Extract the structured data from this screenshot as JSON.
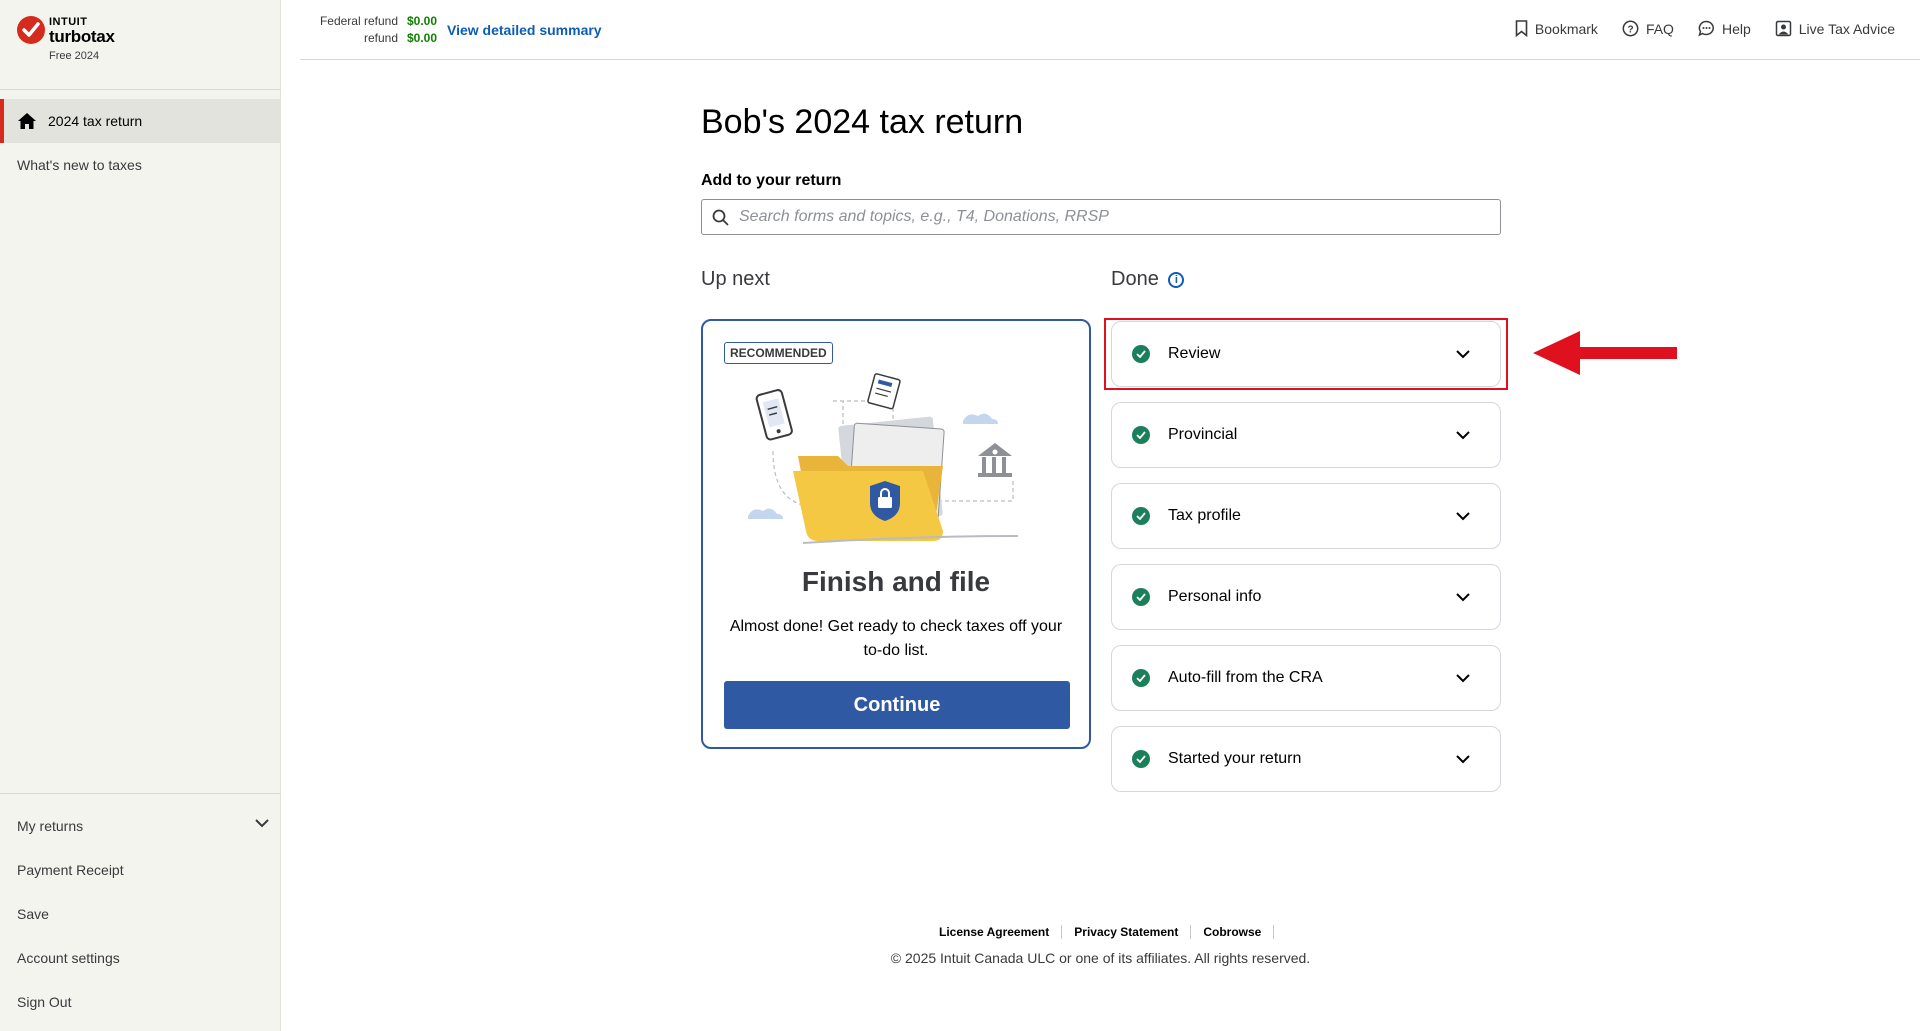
{
  "brand": {
    "top": "INTUIT",
    "name": "turbotax",
    "edition": "Free 2024",
    "accent": "#d52b1e"
  },
  "sidebar": {
    "active_item": "2024 tax return",
    "links": [
      "What's new to taxes"
    ],
    "bottom": [
      "My returns",
      "Payment Receipt",
      "Save",
      "Account settings",
      "Sign Out"
    ]
  },
  "header": {
    "refund_label_1": "Federal refund",
    "refund_label_2": "refund",
    "refund_value_1": "$0.00",
    "refund_value_2": "$0.00",
    "summary_link": "View detailed summary",
    "nav": [
      "Bookmark",
      "FAQ",
      "Help",
      "Live Tax Advice"
    ]
  },
  "main": {
    "title": "Bob's 2024 tax return",
    "add_label": "Add to your return",
    "search_placeholder": "Search forms and topics, e.g., T4, Donations, RRSP",
    "up_next_label": "Up next",
    "done_label": "Done",
    "card": {
      "badge": "RECOMMENDED",
      "title": "Finish and file",
      "description": "Almost done! Get ready to check taxes off your to-do list.",
      "button": "Continue"
    },
    "done_items": [
      "Review",
      "Provincial",
      "Tax profile",
      "Personal info",
      "Auto-fill from the CRA",
      "Started your return"
    ]
  },
  "footer": {
    "links": [
      "License Agreement",
      "Privacy Statement",
      "Cobrowse"
    ],
    "copyright": "© 2025 Intuit Canada ULC or one of its affiliates. All rights reserved."
  },
  "colors": {
    "primary": "#2f5aa3",
    "success": "#1b7f5b",
    "link": "#0d5db3",
    "highlight": "#e0111e"
  }
}
